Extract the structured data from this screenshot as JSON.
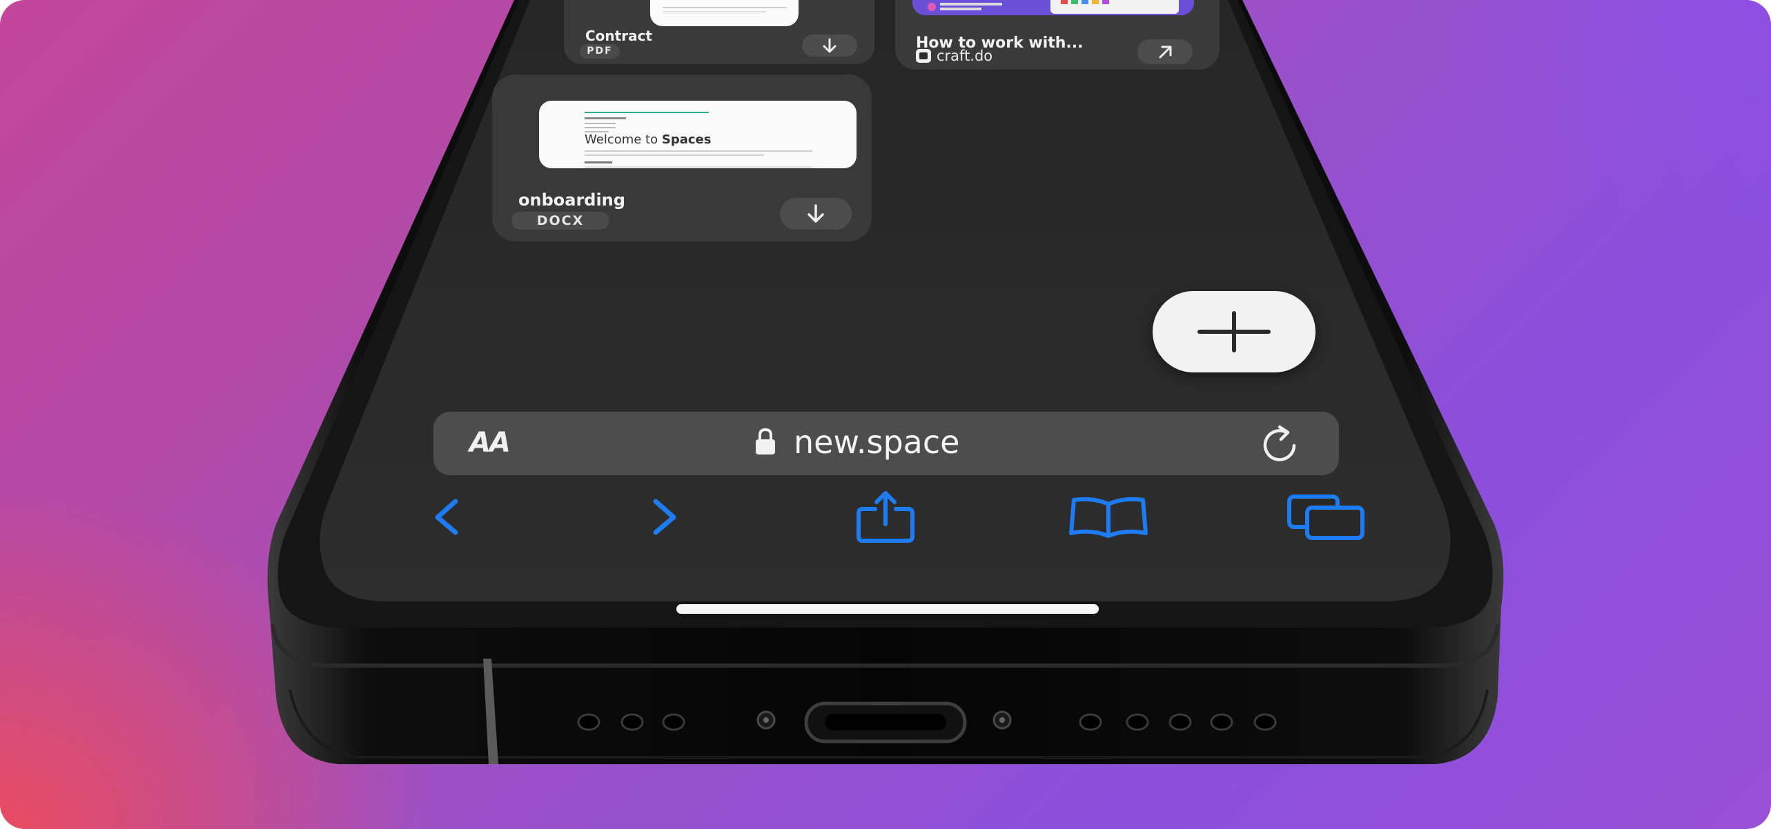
{
  "cards": {
    "contract": {
      "title": "Contract",
      "type": "PDF"
    },
    "craft": {
      "title": "How to work with...",
      "source": "craft.do"
    },
    "onboarding": {
      "title": "onboarding",
      "type": "DOCX",
      "preview_heading_prefix": "Welcome to ",
      "preview_heading_bold": "Spaces"
    }
  },
  "address_bar": {
    "text_size_label": "AA",
    "url": "new.space"
  },
  "toolbar": {
    "items": [
      "back",
      "forward",
      "share",
      "bookmarks",
      "tabs"
    ]
  },
  "colors": {
    "accent_blue": "#1e7cf2",
    "screen": "#2b2b2b",
    "card": "#3a3a3a",
    "address_bar": "#4d4d4d",
    "fab": "#f2f2f2"
  },
  "icons": {
    "download": "arrow-down",
    "open_link": "arrow-up-right",
    "lock": "lock",
    "reload": "arrow-clockwise",
    "add": "plus"
  }
}
